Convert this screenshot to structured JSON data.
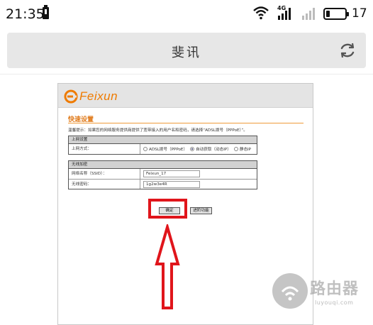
{
  "status_bar": {
    "time": "21:35",
    "network_label_1": "4G",
    "battery_percent": "17",
    "icons": [
      "battery-small-icon",
      "wifi-icon",
      "signal-icon",
      "signal-icon",
      "battery-icon"
    ]
  },
  "browser": {
    "page_title": "斐讯",
    "reload_icon": "reload-icon"
  },
  "router_page": {
    "logo_text": "Feixun",
    "section_title": "快速设置",
    "tip": "温馨提示：如果您的网络服务提供商提供了宽带接入的用户名和密码，请选择“ADSL拨号（PPPoE）”。",
    "wan_table": {
      "header": "上网设置",
      "row_label": "上网方式：",
      "options": [
        {
          "label": "ADSL拨号（PPPoE）",
          "selected": false
        },
        {
          "label": "自动获取（动态IP）",
          "selected": true
        },
        {
          "label": "静态IP",
          "selected": false
        }
      ]
    },
    "wifi_table": {
      "header": "无线加密",
      "ssid_label": "网络名称（SSID）：",
      "ssid_value": "Feixun_17",
      "password_label": "无线密码：",
      "password_value": "1g2w3e4R"
    },
    "confirm_button": "确定",
    "advanced_button": "进阶功能"
  },
  "annotation": {
    "highlight_color": "#e0151b"
  },
  "watermark": {
    "text": "路由器",
    "sub": "luyouqi.com"
  },
  "colors": {
    "brand": "#ef7b00",
    "section": "#e07a1a"
  }
}
